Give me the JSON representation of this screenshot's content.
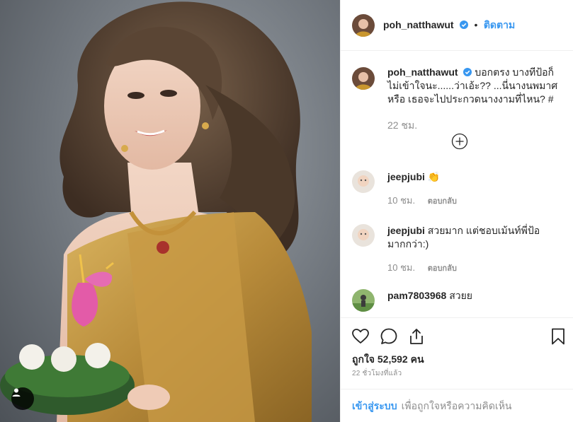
{
  "post": {
    "username": "poh_natthawut",
    "follow_label": "ติดตาม",
    "separator": "•"
  },
  "caption": {
    "username": "poh_natthawut",
    "text": "บอกตรง บางทีป้อก็ไม่เข้าใจนะ......ว่าเอ้ะ?? ...นี่นางนพมาศ หรือ เธอจะไปประกวดนางงามที่ไหน? #",
    "age": "22 ชม."
  },
  "comments": [
    {
      "username": "jeepjubi",
      "text": "👏",
      "age": "10 ชม.",
      "reply_label": "ตอบกลับ"
    },
    {
      "username": "jeepjubi",
      "text": "สวยมาก แต่ชอบเม้นท์พี่ป้อมากกว่า:)",
      "age": "10 ชม.",
      "reply_label": "ตอบกลับ"
    },
    {
      "username": "pam7803968",
      "text": "สวยย"
    }
  ],
  "likes": {
    "label": "ถูกใจ 52,592 คน"
  },
  "timestamp": "22 ชั่วโมงที่แล้ว",
  "login_bar": {
    "link": "เข้าสู่ระบบ",
    "text": "เพื่อถูกใจหรือความคิดเห็น"
  },
  "colors": {
    "accent": "#3897f0",
    "muted": "#8e8e8e",
    "border": "#efefef",
    "text": "#262626"
  },
  "icons": [
    "heart-icon",
    "comment-icon",
    "share-icon",
    "bookmark-icon",
    "verified-badge-icon",
    "add-icon",
    "user-tag-icon"
  ]
}
